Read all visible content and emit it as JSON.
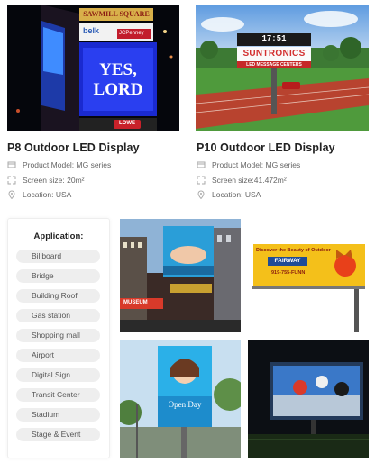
{
  "products": [
    {
      "title": "P8 Outdoor LED Display",
      "specs": [
        {
          "icon": "box-icon",
          "text": "Product Model: MG series"
        },
        {
          "icon": "expand-icon",
          "text": "Screen size: 20m²"
        },
        {
          "icon": "location-pin-icon",
          "text": "Location: USA"
        }
      ],
      "image": {
        "signs": [
          "SAWMILL SQUARE",
          "belk",
          "JCPenney",
          "YES, LORD",
          "LOWE"
        ]
      }
    },
    {
      "title": "P10 Outdoor LED Display",
      "specs": [
        {
          "icon": "box-icon",
          "text": "Product Model: MG series"
        },
        {
          "icon": "expand-icon",
          "text": "Screen size:41.472m²"
        },
        {
          "icon": "location-pin-icon",
          "text": "Location: USA"
        }
      ],
      "image": {
        "clock": "17:51",
        "brand": "SUNTRONICS",
        "tagline": "LED MESSAGE CENTERS"
      }
    }
  ],
  "application": {
    "title": "Application:",
    "items": [
      "Billboard",
      "Bridge",
      "Building Roof",
      "Gas station",
      "Shopping mall",
      "Airport",
      "Digital Sign",
      "Transit Center",
      "Stadium",
      "Stage & Event"
    ]
  },
  "gallery": {
    "billboard_headline": "Discover the Beauty of Outdoor",
    "billboard_brand": "FAIRWAY",
    "billboard_phone": "919-755-FUNN",
    "poster_text": "Open Day",
    "times_sq_sign": "MUSEUM"
  },
  "colors": {
    "title": "#222222",
    "spec_text": "#666666",
    "pill_bg": "#eeeeee",
    "pill_text": "#555555"
  }
}
